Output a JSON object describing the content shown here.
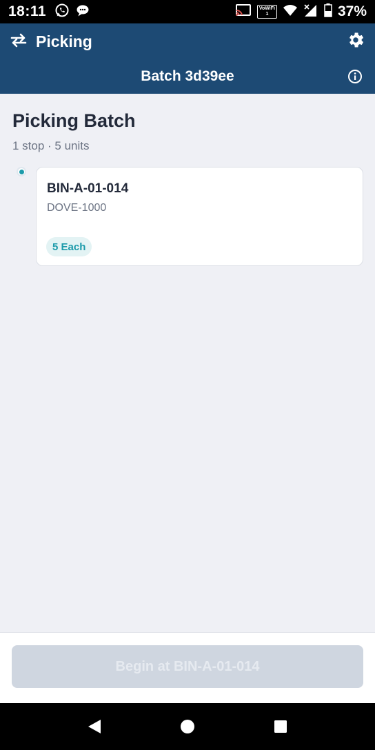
{
  "status_bar": {
    "time": "18:11",
    "vowifi_top": "VoWiFi",
    "vowifi_bottom": "1",
    "battery_percent": "37%"
  },
  "app_bar": {
    "title": "Picking",
    "left_icon": "swap-arrows-icon",
    "right_icon": "gear-icon"
  },
  "batch_bar": {
    "title": "Batch 3d39ee",
    "right_icon": "info-icon"
  },
  "page": {
    "title": "Picking Batch",
    "subtitle": "1 stop · 5 units"
  },
  "stops": [
    {
      "location": "BIN-A-01-014",
      "sku": "DOVE-1000",
      "quantity": "5 Each"
    }
  ],
  "footer": {
    "begin_label": "Begin at BIN-A-01-014"
  },
  "colors": {
    "header": "#1d4a74",
    "accent": "#1b9aaa",
    "background": "#eff0f5",
    "button_disabled": "#cfd6e0"
  }
}
